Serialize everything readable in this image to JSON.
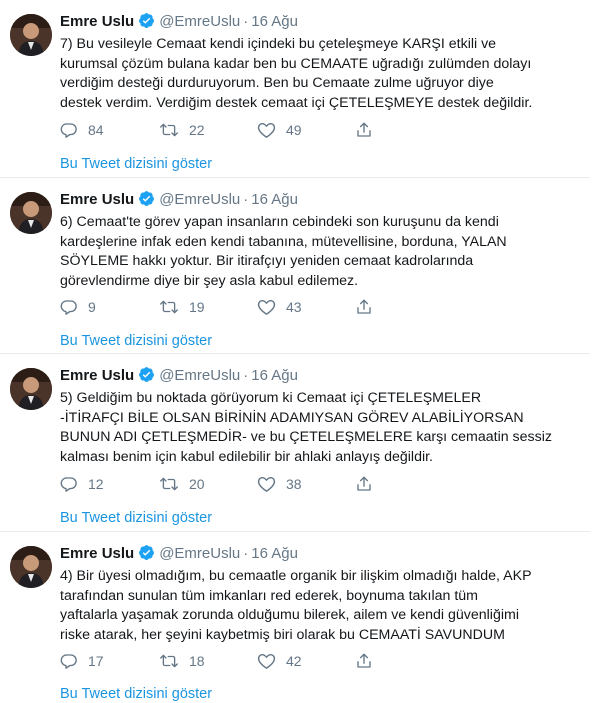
{
  "tweets": [
    {
      "name": "Emre Uslu",
      "handle": "@EmreUslu",
      "dot": "·",
      "date": "16 Ağu",
      "lines": [
        "7) Bu vesileyle Cemaat kendi içindeki bu çeteleşmeye KARŞI etkili ve",
        "kurumsal çözüm bulana kadar ben bu CEMAATE uğradığı zulümden dolayı",
        "verdiğim desteği durduruyorum.  Ben bu Cemaate zulme uğruyor diye",
        "destek verdim. Verdiğim destek cemaat içi ÇETELEŞMEYE destek değildir."
      ],
      "replies": "84",
      "retweets": "22",
      "likes": "49",
      "thread_link": "Bu Tweet dizisini göster"
    },
    {
      "name": "Emre Uslu",
      "handle": "@EmreUslu",
      "dot": "·",
      "date": "16 Ağu",
      "lines": [
        "6) Cemaat'te görev yapan insanların cebindeki son kuruşunu da kendi",
        "kardeşlerine infak eden kendi tabanına, mütevellisine, borduna, YALAN",
        "SÖYLEME hakkı yoktur. Bir itirafçıyı yeniden cemaat kadrolarında",
        "görevlendirme diye bir şey asla kabul edilemez."
      ],
      "replies": "9",
      "retweets": "19",
      "likes": "43",
      "thread_link": "Bu Tweet dizisini göster"
    },
    {
      "name": "Emre Uslu",
      "handle": "@EmreUslu",
      "dot": "·",
      "date": "16 Ağu",
      "lines": [
        "5) Geldiğim bu noktada görüyorum ki Cemaat içi ÇETELEŞMELER",
        "-İTİRAFÇI BİLE OLSAN BİRİNİN ADAMIYSAN GÖREV ALABİLİYORSAN",
        "BUNUN ADI ÇETLEŞMEDİR- ve bu ÇETELEŞMELERE karşı cemaatin sessiz",
        "kalması benim için kabul edilebilir bir ahlaki anlayış değildir."
      ],
      "replies": "12",
      "retweets": "20",
      "likes": "38",
      "thread_link": "Bu Tweet dizisini göster"
    },
    {
      "name": "Emre Uslu",
      "handle": "@EmreUslu",
      "dot": "·",
      "date": "16 Ağu",
      "lines": [
        "4) Bir üyesi olmadığım, bu cemaatle organik bir ilişkim olmadığı halde, AKP",
        "tarafından sunulan tüm imkanları red ederek, boynuma takılan tüm",
        "yaftalarla yaşamak zorunda olduğumu bilerek, ailem ve kendi güvenliğimi",
        "riske atarak, her şeyini kaybetmiş biri olarak bu CEMAATİ SAVUNDUM"
      ],
      "replies": "17",
      "retweets": "18",
      "likes": "42",
      "thread_link": "Bu Tweet dizisini göster"
    }
  ],
  "colors": {
    "link": "#1b95e0",
    "verified": "#1da1f2",
    "muted": "#657786",
    "divider": "#e6ecf0"
  },
  "icons": {
    "reply": "reply-icon",
    "retweet": "retweet-icon",
    "like": "heart-icon",
    "share": "share-icon",
    "verified": "verified-badge-icon"
  }
}
